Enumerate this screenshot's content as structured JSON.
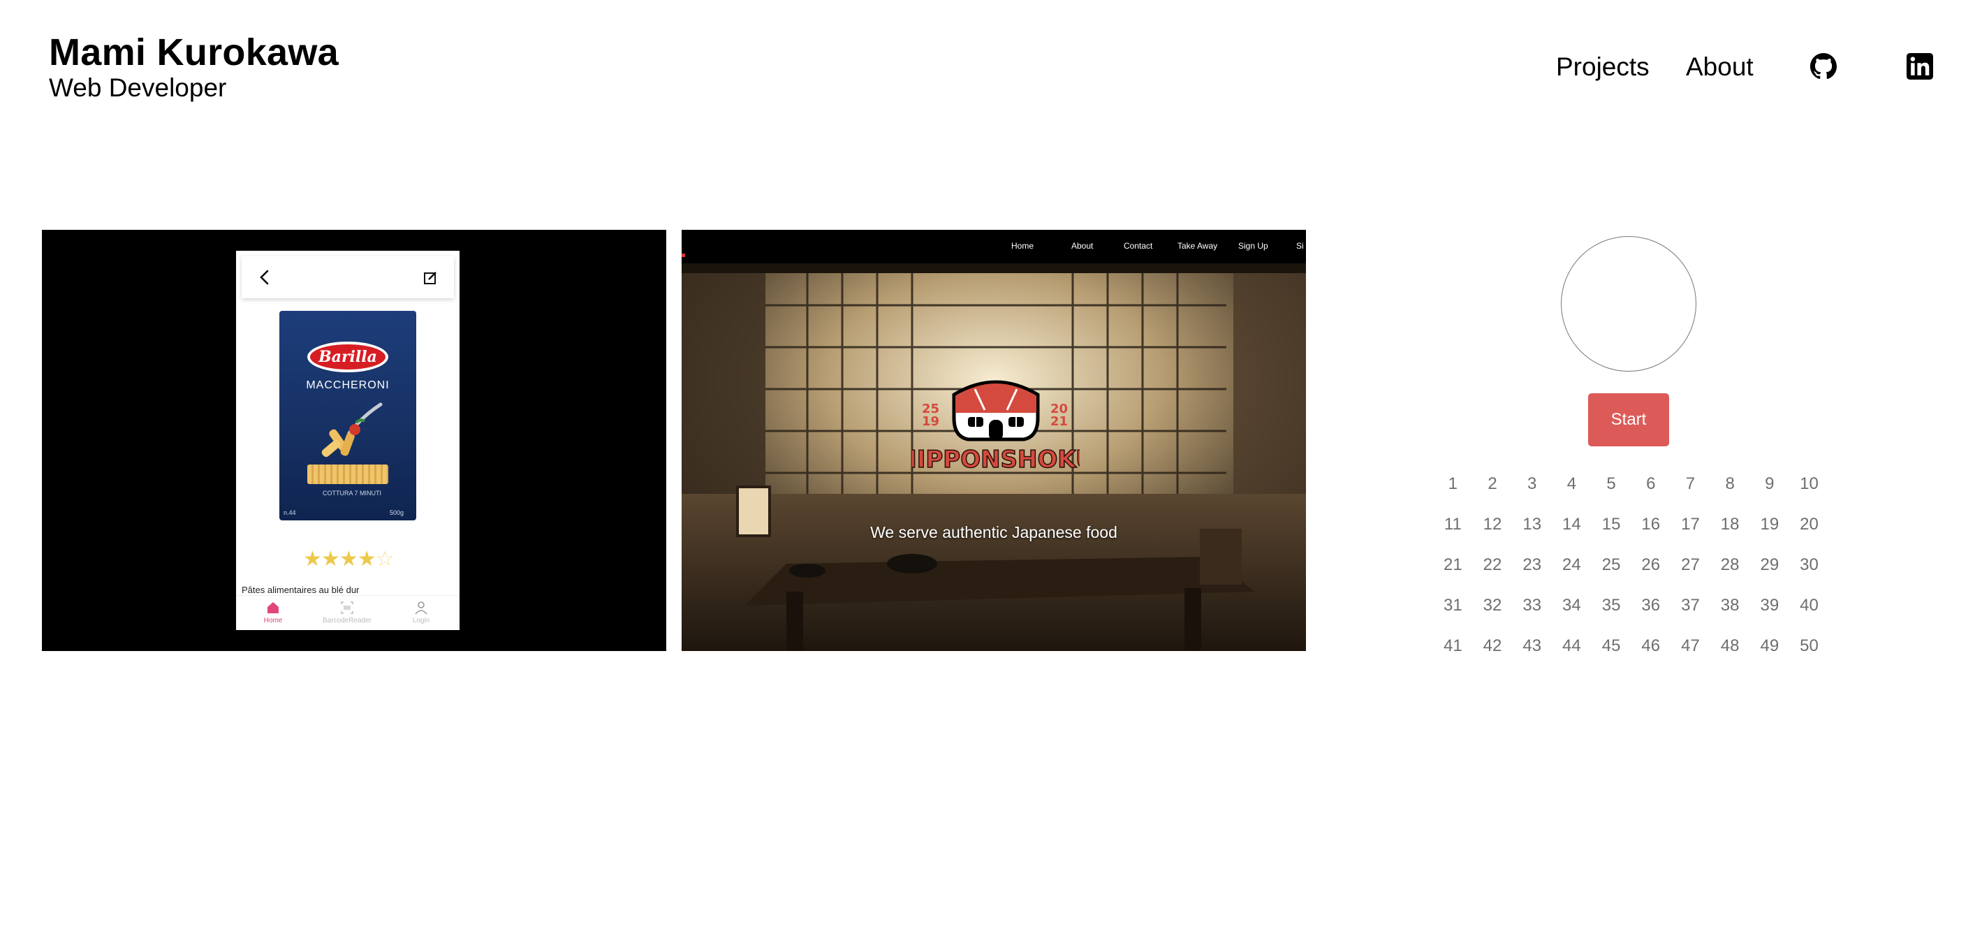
{
  "header": {
    "name": "Mami Kurokawa",
    "role": "Web Developer",
    "nav": {
      "projects": "Projects",
      "about": "About"
    },
    "icons": {
      "github": "github-icon",
      "linkedin": "linkedin-icon"
    }
  },
  "projects": {
    "barcode_app": {
      "product_brand": "Barilla",
      "product_name": "MACCHERONI",
      "product_small_1": "COTTURA 7 MINUTI",
      "product_small_2": "n.44",
      "product_small_3": "500g",
      "rating": {
        "value": 4,
        "max": 5
      },
      "description": "Pâtes alimentaires au blé dur",
      "tabs": [
        "Home",
        "BarcodeReader",
        "Login"
      ],
      "accent": "#e0457b"
    },
    "restaurant_site": {
      "nav_items": [
        "Home",
        "About",
        "Contact",
        "Take Away",
        "Sign Up",
        "Si"
      ],
      "logo_text": "NIPPONSHOKU",
      "logo_years": [
        "25",
        "19",
        "20",
        "21"
      ],
      "tagline": "We serve authentic Japanese food"
    }
  },
  "timer": {
    "start_label": "Start",
    "button_color": "#dc5b58",
    "numbers": [
      "1",
      "2",
      "3",
      "4",
      "5",
      "6",
      "7",
      "8",
      "9",
      "10",
      "11",
      "12",
      "13",
      "14",
      "15",
      "16",
      "17",
      "18",
      "19",
      "20",
      "21",
      "22",
      "23",
      "24",
      "25",
      "26",
      "27",
      "28",
      "29",
      "30",
      "31",
      "32",
      "33",
      "34",
      "35",
      "36",
      "37",
      "38",
      "39",
      "40",
      "41",
      "42",
      "43",
      "44",
      "45",
      "46",
      "47",
      "48",
      "49",
      "50"
    ]
  }
}
